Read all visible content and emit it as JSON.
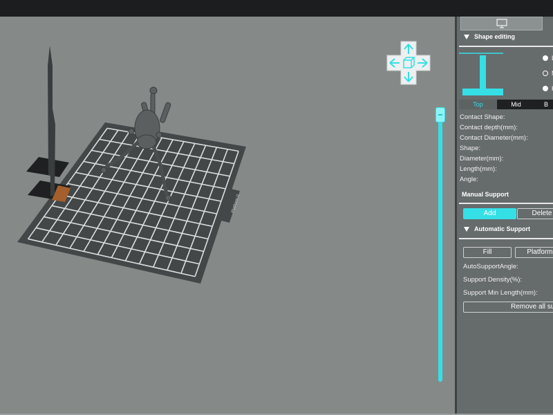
{
  "viewport": {
    "platform_label": "Platform 0"
  },
  "panel": {
    "shape_editing_title": "Shape editing",
    "radio_options": [
      {
        "label": "L",
        "selected": true
      },
      {
        "label": "M",
        "selected": false
      },
      {
        "label": "H",
        "selected": true
      }
    ],
    "tabs": [
      {
        "label": "Top",
        "active": true
      },
      {
        "label": "Mid",
        "active": false
      },
      {
        "label": "B",
        "active": false
      }
    ],
    "fields": [
      "Contact Shape:",
      "Contact depth(mm):",
      "Contact Diameter(mm):",
      "Shape:",
      "Diameter(mm):",
      "Length(mm):",
      "Angle:"
    ],
    "manual_support_title": "Manual Support",
    "add_label": "Add",
    "delete_label": "Delete",
    "automatic_support_title": "Automatic Support",
    "fill_label": "Fill",
    "platform_label": "Platform",
    "auto_fields": [
      "AutoSupportAngle:",
      "Support Density(%):",
      "Support Min Length(mm):"
    ],
    "remove_all_label": "Remove all sup"
  },
  "colors": {
    "accent": "#35dfe6",
    "background": "#858a89",
    "panel": "#666b6c",
    "plate": "#444748"
  },
  "icons": {
    "top_button": "monitor-icon",
    "nav_cube": "cube-icon",
    "nav_arrows": [
      "arrow-up-icon",
      "arrow-down-icon",
      "arrow-left-icon",
      "arrow-right-icon"
    ]
  }
}
